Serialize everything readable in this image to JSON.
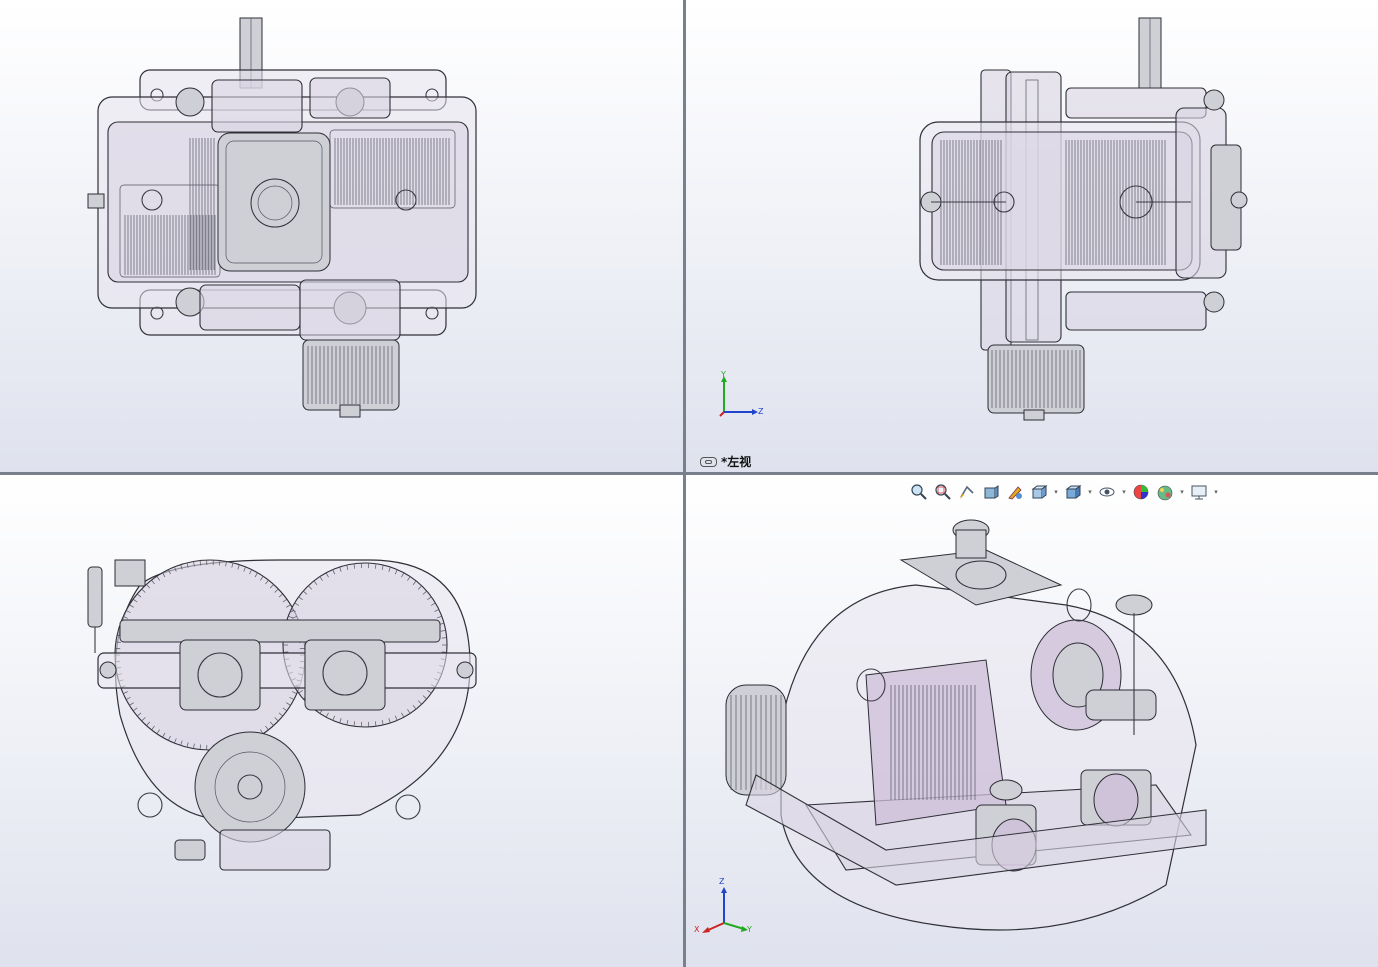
{
  "viewports": {
    "top_left": {
      "name": "top-view"
    },
    "top_right": {
      "name": "left-view",
      "label": "*左视",
      "triad": {
        "y": "Y",
        "z": "Z"
      }
    },
    "bottom_left": {
      "name": "front-view"
    },
    "bottom_right": {
      "name": "isometric-view",
      "triad": {
        "z": "Z",
        "x": "X",
        "y": "Y"
      }
    }
  },
  "toolbar": {
    "buttons": [
      {
        "icon": "zoom-to-fit-icon",
        "has_dropdown": false
      },
      {
        "icon": "zoom-to-area-icon",
        "has_dropdown": false
      },
      {
        "icon": "previous-view-icon",
        "has_dropdown": false
      },
      {
        "icon": "section-view-icon",
        "has_dropdown": false
      },
      {
        "icon": "dynamic-annotation-icon",
        "has_dropdown": false
      },
      {
        "icon": "view-orientation-icon",
        "has_dropdown": true
      },
      {
        "icon": "display-style-icon",
        "has_dropdown": true
      },
      {
        "icon": "hide-show-items-icon",
        "has_dropdown": true
      },
      {
        "icon": "edit-appearance-icon",
        "has_dropdown": false
      },
      {
        "icon": "apply-scene-icon",
        "has_dropdown": true
      },
      {
        "icon": "view-settings-icon",
        "has_dropdown": true
      }
    ]
  },
  "colors": {
    "background_top": "#ffffff",
    "background_bottom": "#dfe2ee",
    "divider": "#7a7f8e",
    "axis_x": "#cc2222",
    "axis_y": "#22aa22",
    "axis_z": "#2244cc"
  }
}
